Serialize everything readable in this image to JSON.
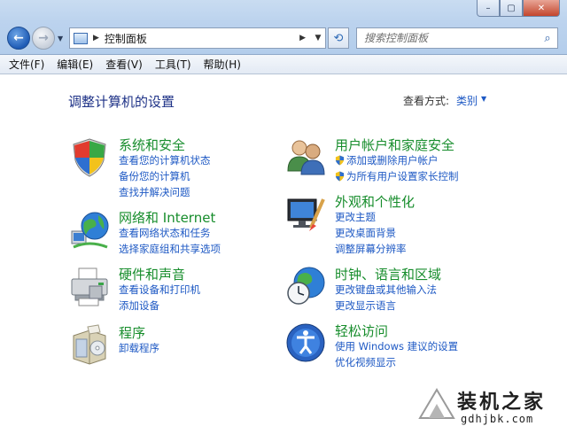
{
  "window": {
    "min_glyph": "–",
    "max_glyph": "▢",
    "close_glyph": "✕"
  },
  "nav": {
    "back_glyph": "←",
    "forward_glyph": "→",
    "dropdown_glyph": "▼"
  },
  "address": {
    "crumb": "控制面板",
    "sep": "▶",
    "dd": "▼"
  },
  "refresh_glyph": "⟲",
  "search": {
    "placeholder": "搜索控制面板",
    "icon": "⌕"
  },
  "menu": {
    "file": "文件(F)",
    "edit": "编辑(E)",
    "view": "查看(V)",
    "tools": "工具(T)",
    "help": "帮助(H)"
  },
  "content": {
    "title": "调整计算机的设置",
    "view_by_label": "查看方式:",
    "view_by_value": "类别",
    "view_by_dd": "▼"
  },
  "categories": {
    "system": {
      "title": "系统和安全",
      "links": [
        "查看您的计算机状态",
        "备份您的计算机",
        "查找并解决问题"
      ]
    },
    "network": {
      "title": "网络和 Internet",
      "links": [
        "查看网络状态和任务",
        "选择家庭组和共享选项"
      ]
    },
    "hardware": {
      "title": "硬件和声音",
      "links": [
        "查看设备和打印机",
        "添加设备"
      ]
    },
    "programs": {
      "title": "程序",
      "links": [
        "卸载程序"
      ]
    },
    "users": {
      "title": "用户帐户和家庭安全",
      "links": [
        "添加或删除用户帐户",
        "为所有用户设置家长控制"
      ]
    },
    "appearance": {
      "title": "外观和个性化",
      "links": [
        "更改主题",
        "更改桌面背景",
        "调整屏幕分辨率"
      ]
    },
    "clock": {
      "title": "时钟、语言和区域",
      "links": [
        "更改键盘或其他输入法",
        "更改显示语言"
      ]
    },
    "ease": {
      "title": "轻松访问",
      "links": [
        "使用 Windows 建议的设置",
        "优化视频显示"
      ]
    }
  },
  "watermark": {
    "text": "装机之家",
    "url": "gdhjbk.com"
  }
}
